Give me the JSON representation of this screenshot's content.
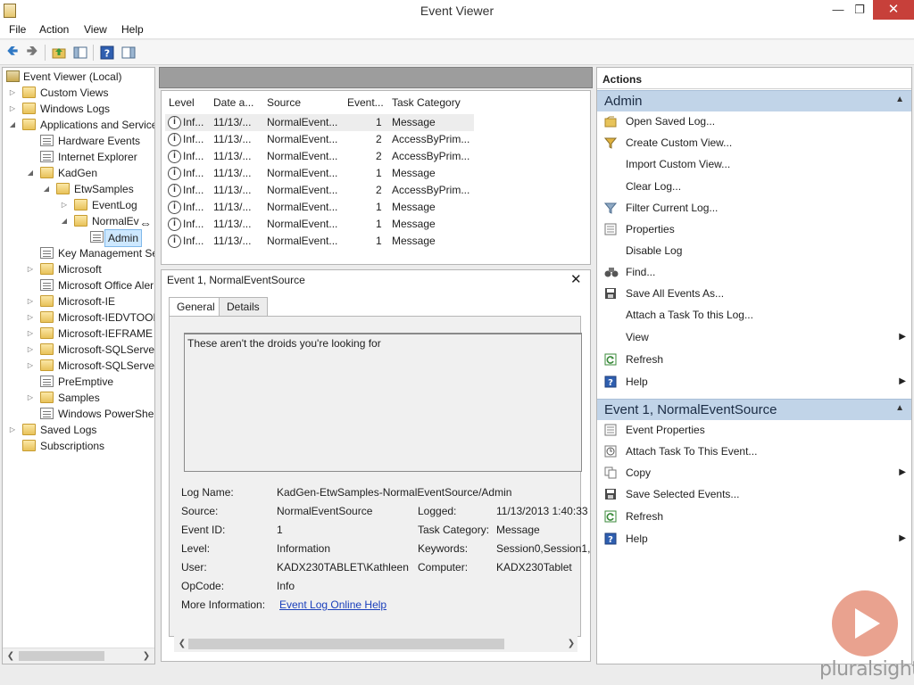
{
  "window": {
    "title": "Event Viewer"
  },
  "menu": [
    "File",
    "Action",
    "View",
    "Help"
  ],
  "tree": {
    "items": [
      {
        "label": "Event Viewer (Local)",
        "expanded": true
      },
      {
        "label": "Custom Views",
        "expanded": false
      },
      {
        "label": "Windows Logs",
        "expanded": false
      },
      {
        "label": "Applications and Service",
        "expanded": true
      },
      {
        "label": "Hardware Events"
      },
      {
        "label": "Internet Explorer"
      },
      {
        "label": "KadGen",
        "expanded": true
      },
      {
        "label": "EtwSamples",
        "expanded": true
      },
      {
        "label": "EventLog",
        "expanded": false
      },
      {
        "label": "NormalEv",
        "expanded": true
      },
      {
        "label": "Admin",
        "selected": true
      },
      {
        "label": "Key Management Se"
      },
      {
        "label": "Microsoft",
        "expanded": false
      },
      {
        "label": "Microsoft Office Aler"
      },
      {
        "label": "Microsoft-IE",
        "expanded": false
      },
      {
        "label": "Microsoft-IEDVTOOL",
        "expanded": false
      },
      {
        "label": "Microsoft-IEFRAME",
        "expanded": false
      },
      {
        "label": "Microsoft-SQLServer",
        "expanded": false
      },
      {
        "label": "Microsoft-SQLServer",
        "expanded": false
      },
      {
        "label": "PreEmptive"
      },
      {
        "label": "Samples",
        "expanded": false
      },
      {
        "label": "Windows PowerShel"
      },
      {
        "label": "Saved Logs",
        "expanded": false
      },
      {
        "label": "Subscriptions"
      }
    ]
  },
  "events": {
    "columns": [
      "Level",
      "Date a...",
      "Source",
      "Event...",
      "Task Category"
    ],
    "rows": [
      {
        "level": "Inf...",
        "date": "11/13/...",
        "source": "NormalEvent...",
        "event_id": "1",
        "task": "Message"
      },
      {
        "level": "Inf...",
        "date": "11/13/...",
        "source": "NormalEvent...",
        "event_id": "2",
        "task": "AccessByPrim..."
      },
      {
        "level": "Inf...",
        "date": "11/13/...",
        "source": "NormalEvent...",
        "event_id": "2",
        "task": "AccessByPrim..."
      },
      {
        "level": "Inf...",
        "date": "11/13/...",
        "source": "NormalEvent...",
        "event_id": "1",
        "task": "Message"
      },
      {
        "level": "Inf...",
        "date": "11/13/...",
        "source": "NormalEvent...",
        "event_id": "2",
        "task": "AccessByPrim..."
      },
      {
        "level": "Inf...",
        "date": "11/13/...",
        "source": "NormalEvent...",
        "event_id": "1",
        "task": "Message"
      },
      {
        "level": "Inf...",
        "date": "11/13/...",
        "source": "NormalEvent...",
        "event_id": "1",
        "task": "Message"
      },
      {
        "level": "Inf...",
        "date": "11/13/...",
        "source": "NormalEvent...",
        "event_id": "1",
        "task": "Message"
      }
    ]
  },
  "detail": {
    "title": "Event 1, NormalEventSource",
    "tabs": [
      "General",
      "Details"
    ],
    "description": "These aren't the droids you're looking for",
    "log_name_label": "Log Name:",
    "log_name": "KadGen-EtwSamples-NormalEventSource/Admin",
    "source_label": "Source:",
    "source": "NormalEventSource",
    "logged_label": "Logged:",
    "logged": "11/13/2013 1:40:33",
    "event_id_label": "Event ID:",
    "event_id": "1",
    "task_category_label": "Task Category:",
    "task_category": "Message",
    "level_label": "Level:",
    "level": "Information",
    "keywords_label": "Keywords:",
    "keywords": "Session0,Session1,",
    "user_label": "User:",
    "user": "KADX230TABLET\\Kathleen",
    "computer_label": "Computer:",
    "computer": "KADX230Tablet",
    "opcode_label": "OpCode:",
    "opcode": "Info",
    "more_info_label": "More Information:",
    "more_info_link": "Event Log Online Help"
  },
  "actions": {
    "header": "Actions",
    "admin_section": {
      "title": "Admin",
      "items": [
        {
          "label": "Open Saved Log...",
          "icon": "open-folder-icon"
        },
        {
          "label": "Create Custom View...",
          "icon": "filter-icon"
        },
        {
          "label": "Import Custom View...",
          "icon": ""
        },
        {
          "label": "Clear Log...",
          "icon": ""
        },
        {
          "label": "Filter Current Log...",
          "icon": "filter-icon"
        },
        {
          "label": "Properties",
          "icon": "properties-icon"
        },
        {
          "label": "Disable Log",
          "icon": ""
        },
        {
          "label": "Find...",
          "icon": "binoculars-icon"
        },
        {
          "label": "Save All Events As...",
          "icon": "save-icon"
        },
        {
          "label": "Attach a Task To this Log...",
          "icon": ""
        },
        {
          "label": "View",
          "icon": "",
          "submenu": true
        },
        {
          "label": "Refresh",
          "icon": "refresh-icon"
        },
        {
          "label": "Help",
          "icon": "help-icon",
          "submenu": true
        }
      ]
    },
    "event_section": {
      "title": "Event 1, NormalEventSource",
      "items": [
        {
          "label": "Event Properties",
          "icon": "properties-icon"
        },
        {
          "label": "Attach Task To This Event...",
          "icon": "task-icon"
        },
        {
          "label": "Copy",
          "icon": "copy-icon",
          "submenu": true
        },
        {
          "label": "Save Selected Events...",
          "icon": "save-icon"
        },
        {
          "label": "Refresh",
          "icon": "refresh-icon"
        },
        {
          "label": "Help",
          "icon": "help-icon",
          "submenu": true
        }
      ]
    }
  },
  "watermark": {
    "text": "pluralsight"
  },
  "colors": {
    "section_header": "#c1d4e8",
    "close_button": "#c7403a",
    "link": "#1a3fbb",
    "watermark": "#e5927b"
  }
}
